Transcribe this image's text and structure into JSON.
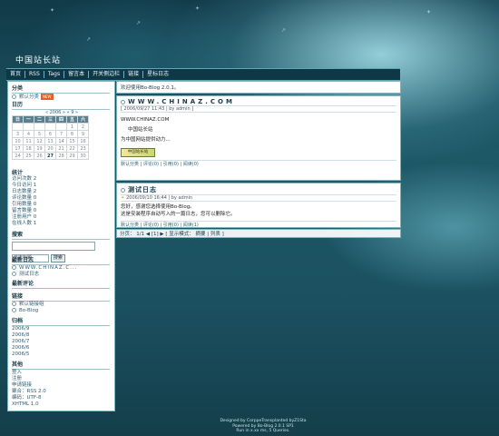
{
  "site": {
    "title": "中国站长站"
  },
  "nav": [
    "首页",
    "RSS",
    "Tags",
    "留言本",
    "开关侧边栏",
    "链接",
    "星标日志"
  ],
  "sidebar": {
    "category": {
      "head": "分类",
      "item": "默认分类",
      "badge": "NEW"
    },
    "calendar": {
      "head": "日历",
      "nav": "« 2006 » « 9 »",
      "weekdays": [
        "日",
        "一",
        "二",
        "三",
        "四",
        "五",
        "六"
      ],
      "rows": [
        [
          "",
          "",
          "",
          "",
          "",
          "1",
          "2"
        ],
        [
          "3",
          "4",
          "5",
          "6",
          "7",
          "8",
          "9"
        ],
        [
          "10",
          "11",
          "12",
          "13",
          "14",
          "15",
          "16"
        ],
        [
          "17",
          "18",
          "19",
          "20",
          "21",
          "22",
          "23"
        ],
        [
          "24",
          "25",
          "26",
          "27",
          "28",
          "29",
          "30"
        ]
      ]
    },
    "stats": {
      "head": "统计",
      "items": [
        "访问次数 2",
        "今日访问 1",
        "日志数量 2",
        "评论数量 0",
        "引用数量 0",
        "留言数量 0",
        "注册用户 0",
        "在线人数 1"
      ]
    },
    "search": {
      "head": "搜索",
      "select": "日志标题",
      "button": "搜索"
    },
    "latest_logs": {
      "head": "最新日志",
      "items": [
        "WWW.CHINAZ.C...",
        "测试日志"
      ]
    },
    "latest_comments": {
      "head": "最新评论"
    },
    "links": {
      "head": "链接",
      "items": [
        "默认链接组",
        "Bo-Blog"
      ]
    },
    "archive": {
      "head": "归档",
      "items": [
        "2006/9",
        "2006/8",
        "2006/7",
        "2006/6",
        "2006/5"
      ]
    },
    "other": {
      "head": "其他",
      "items": [
        "登入",
        "注册",
        "申请链接",
        "聚合：RSS 2.0",
        "编码：UTF-8",
        "XHTML 1.0"
      ]
    }
  },
  "main": {
    "welcome": "欢迎使用Bo-Blog 2.0.1。",
    "post1": {
      "title": "WWW.CHINAZ.COM",
      "meta": "[ 2006/09/27 11:43 | by admin ]",
      "line1": "WWW.CHINAZ.COM",
      "line2": "中国站长站",
      "line3": "为中国网站提供动力...",
      "banner": "中国站长站",
      "links": "默认分类 | 评论(0) | 引用(0) | 阅读(0)"
    },
    "post2": {
      "title": "测试日志",
      "meta": "2006/09/10 16:44 | by admin",
      "line1": "您好，感谢您选择使用Bo-Blog。",
      "line2": "这是安装程序自动写入的一篇日志，您可以删除它。",
      "links": "默认分类 | 评论(0) | 引用(0) | 阅读(1)"
    },
    "pager": "分页： 1/1 ◀ [1] ▶ [ 显示模式： 摘要 | 列表 ]"
  },
  "footer": [
    "Designed by CorppeTransplanted byZ1Sta",
    "Powered by Bo-Blog 2.0.1 SP1",
    "Run in x.xx ms, 5 Queries."
  ],
  "colors": {
    "accent": "#0f3846",
    "panel": "#ffffff",
    "link": "#2d5e74"
  }
}
